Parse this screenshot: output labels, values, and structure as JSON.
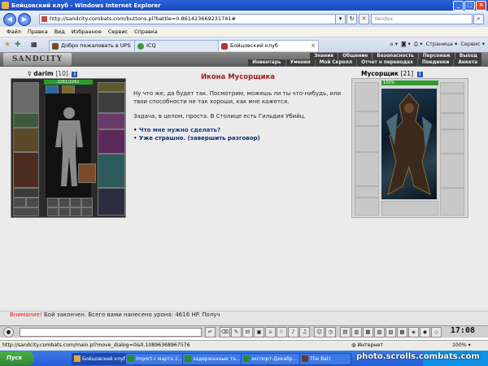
{
  "window": {
    "title": "Бойцовский клуб - Windows Internet Explorer"
  },
  "address": {
    "url": "http://sandcity.combats.com/buttons.pl?battle=0.861423669231741#"
  },
  "search": {
    "placeholder": "Yandex"
  },
  "menu": [
    "Файл",
    "Правка",
    "Вид",
    "Избранное",
    "Сервис",
    "Справка"
  ],
  "tabs": [
    {
      "label": "Добро пожаловать в UPS"
    },
    {
      "label": "ICQ"
    },
    {
      "label": "Бойцовский клуб"
    }
  ],
  "browser_tools": {
    "page": "Страница",
    "service": "Сервис"
  },
  "game": {
    "logo": "SANDCITY",
    "nav_top": [
      "Знания",
      "Общение",
      "Безопасность",
      "Персонаж",
      "Выход"
    ],
    "nav_bottom": [
      "Инвентарь",
      "Умения",
      "Мой Скролл",
      "Отчет о переводах",
      "Поединки",
      "Анкета"
    ]
  },
  "player": {
    "name": "darim",
    "level": "[10]",
    "hp": "2261/2261"
  },
  "dialog": {
    "title": "Икона Мусорщика",
    "text1": "Ну что же, да будет так. Посмотрим, можешь ли ты что-нибудь, или твои способности не так хороши, как мне кажется.",
    "text2": "Задача, в целом, проста. В Столице есть Гильдия Убийц.",
    "option1": "Что мне нужно сделать?",
    "option2": "Уже страшно. (завершить разговор)"
  },
  "mob": {
    "name": "Мусорщик",
    "level": "[21]",
    "hp": "100%"
  },
  "chat": {
    "sys": "Внимание!",
    "text": "Бой закончен. Всего вами нанесено урона: 4616 HP. Получ"
  },
  "clock": "17:08",
  "status": {
    "url": "http://sandcity.combats.com/main.pl?move_dialog=0&0.10896368967576",
    "zone": "Интернет",
    "zoom": "100%"
  },
  "taskbar": {
    "start": "Пуск",
    "items": [
      "Бойцовский клуб...",
      "import с марта 2...",
      "задержанные та...",
      "экспорт-Декабр...",
      "The Bat!"
    ]
  },
  "watermark": "photo.scrolls.combats.com"
}
